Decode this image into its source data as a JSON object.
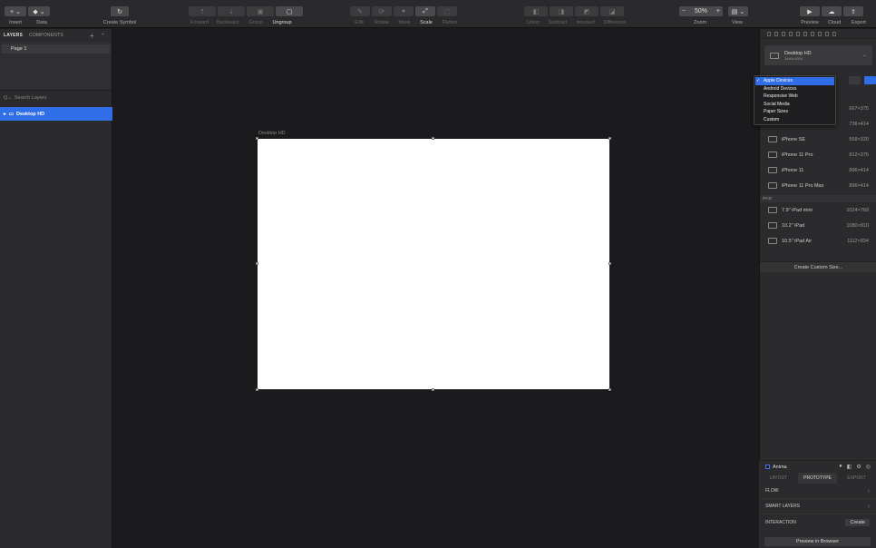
{
  "toolbar": {
    "insert_label": "Insert",
    "data_label": "Data",
    "create_symbol_label": "Create Symbol",
    "forward_label": "Forward",
    "backward_label": "Backward",
    "group_label": "Group",
    "ungroup_label": "Ungroup",
    "edit_label": "Edit",
    "rotate_label": "Rotate",
    "mask_label": "Mask",
    "scale_label": "Scale",
    "flatten_label": "Flatten",
    "union_label": "Union",
    "subtract_label": "Subtract",
    "intersect_label": "Intersect",
    "difference_label": "Difference",
    "zoom_label": "Zoom",
    "zoom_value": "50%",
    "view_label": "View",
    "preview_label": "Preview",
    "cloud_label": "Cloud",
    "export_label": "Export"
  },
  "left_panel": {
    "tab_layers": "LAYERS",
    "tab_components": "COMPONENTS",
    "page_name": "Page 1",
    "search_placeholder": "Search Layers",
    "layer_name": "Desktop HD"
  },
  "canvas": {
    "artboard_label": "Desktop HD"
  },
  "right_panel": {
    "preset_name": "Desktop HD",
    "preset_size": "1440×1024",
    "dropdown_options": [
      {
        "label": "Apple Devices",
        "selected": true
      },
      {
        "label": "Android Devices",
        "selected": false
      },
      {
        "label": "Responsive Web",
        "selected": false
      },
      {
        "label": "Social Media",
        "selected": false
      },
      {
        "label": "Paper Sizes",
        "selected": false
      },
      {
        "label": "Custom",
        "selected": false
      }
    ],
    "iphone_rows": [
      {
        "name": "",
        "size": "667×375"
      },
      {
        "name": "",
        "size": "736×414"
      },
      {
        "name": "iPhone SE",
        "size": "568×320"
      },
      {
        "name": "iPhone 11 Pro",
        "size": "812×375"
      },
      {
        "name": "iPhone 11",
        "size": "896×414"
      },
      {
        "name": "iPhone 11 Pro Max",
        "size": "896×414"
      }
    ],
    "ipad_header": "IPAD",
    "ipad_rows": [
      {
        "name": "7.9\" iPad mini",
        "size": "1024×768"
      },
      {
        "name": "10.2\" iPad",
        "size": "1080×810"
      },
      {
        "name": "10.5\" iPad Air",
        "size": "1112×834"
      }
    ],
    "create_custom_label": "Create Custom Size..."
  },
  "anima": {
    "title": "Anima",
    "tab_layout": "LAYOUT",
    "tab_prototype": "PROTOTYPE",
    "tab_export": "EXPORT",
    "row_flow": "FLOW",
    "row_smart_layers": "SMART LAYERS",
    "row_interaction": "INTERACTION",
    "create_label": "Create",
    "preview_browser_label": "Preview in Browser"
  },
  "colors": {
    "accent": "#2f6ee6",
    "canvas_bg": "#1b1b1d",
    "panel_bg": "#2b2b2d",
    "artboard": "#ffffff"
  }
}
